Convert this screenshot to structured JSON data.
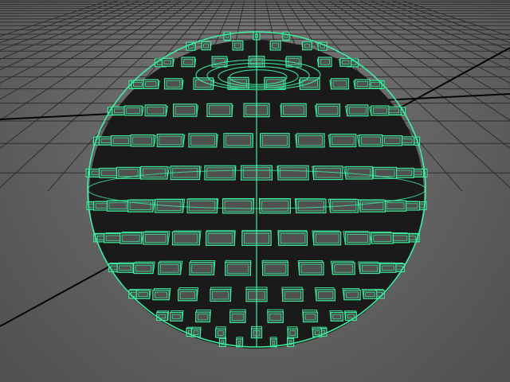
{
  "viewport": {
    "background_top": "#777777",
    "background_bottom": "#4a4a4a",
    "grid_line_color": "#2e2e2e",
    "axis_line_color": "#050505"
  },
  "object": {
    "wire_color": "#3cf0a0",
    "face_color": "#3f3f3f",
    "shadow_color": "#1a1a1a",
    "selected": true
  }
}
